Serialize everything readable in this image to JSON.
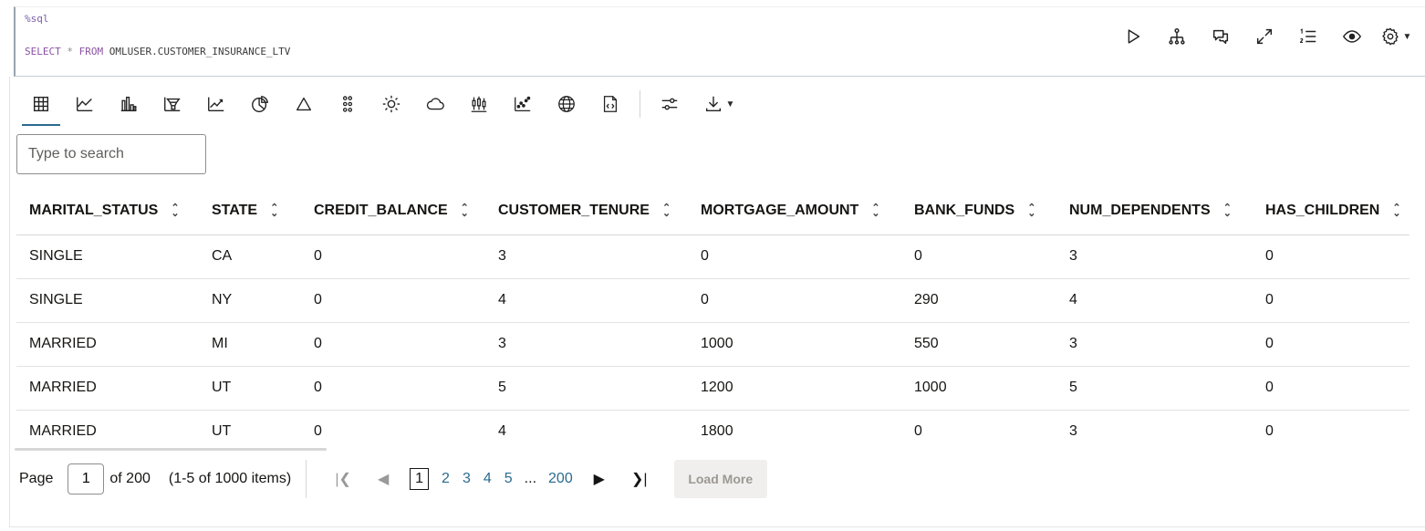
{
  "cell": {
    "line1": "%sql",
    "line2": {
      "kw1": "SELECT",
      "op": "*",
      "kw2": "FROM",
      "rest": "OMLUSER.CUSTOMER_INSURANCE_LTV"
    }
  },
  "cell_tools": [
    "run-icon",
    "dependency-tree-icon",
    "comments-icon",
    "expand-icon",
    "line-numbers-icon",
    "visibility-icon",
    "settings-icon"
  ],
  "viz_tools": [
    "table-icon",
    "line-chart-icon",
    "bar-chart-icon",
    "funnel-chart-icon",
    "trend-chart-icon",
    "pie-chart-icon",
    "pyramid-chart-icon",
    "dots-grid-icon",
    "sunburst-icon",
    "word-cloud-icon",
    "boxplot-icon",
    "scatter-icon",
    "map-icon",
    "code-file-icon"
  ],
  "search": {
    "placeholder": "Type to search"
  },
  "table": {
    "columns": [
      "MARITAL_STATUS",
      "STATE",
      "CREDIT_BALANCE",
      "CUSTOMER_TENURE",
      "MORTGAGE_AMOUNT",
      "BANK_FUNDS",
      "NUM_DEPENDENTS",
      "HAS_CHILDREN"
    ],
    "rows": [
      [
        "SINGLE",
        "CA",
        "0",
        "3",
        "0",
        "0",
        "3",
        "0"
      ],
      [
        "SINGLE",
        "NY",
        "0",
        "4",
        "0",
        "290",
        "4",
        "0"
      ],
      [
        "MARRIED",
        "MI",
        "0",
        "3",
        "1000",
        "550",
        "3",
        "0"
      ],
      [
        "MARRIED",
        "UT",
        "0",
        "5",
        "1200",
        "1000",
        "5",
        "0"
      ],
      [
        "MARRIED",
        "UT",
        "0",
        "4",
        "1800",
        "0",
        "3",
        "0"
      ]
    ]
  },
  "pager": {
    "page_label": "Page",
    "page_value": "1",
    "of_label": "of 200",
    "range_label": "(1-5 of 1000 items)",
    "pages": [
      "1",
      "2",
      "3",
      "4",
      "5"
    ],
    "ellipsis": "...",
    "last_page": "200",
    "load_more": "Load More"
  },
  "colors": {
    "accent": "#2b6b8f",
    "text": "#161513",
    "keyword": "#8a52a3"
  }
}
